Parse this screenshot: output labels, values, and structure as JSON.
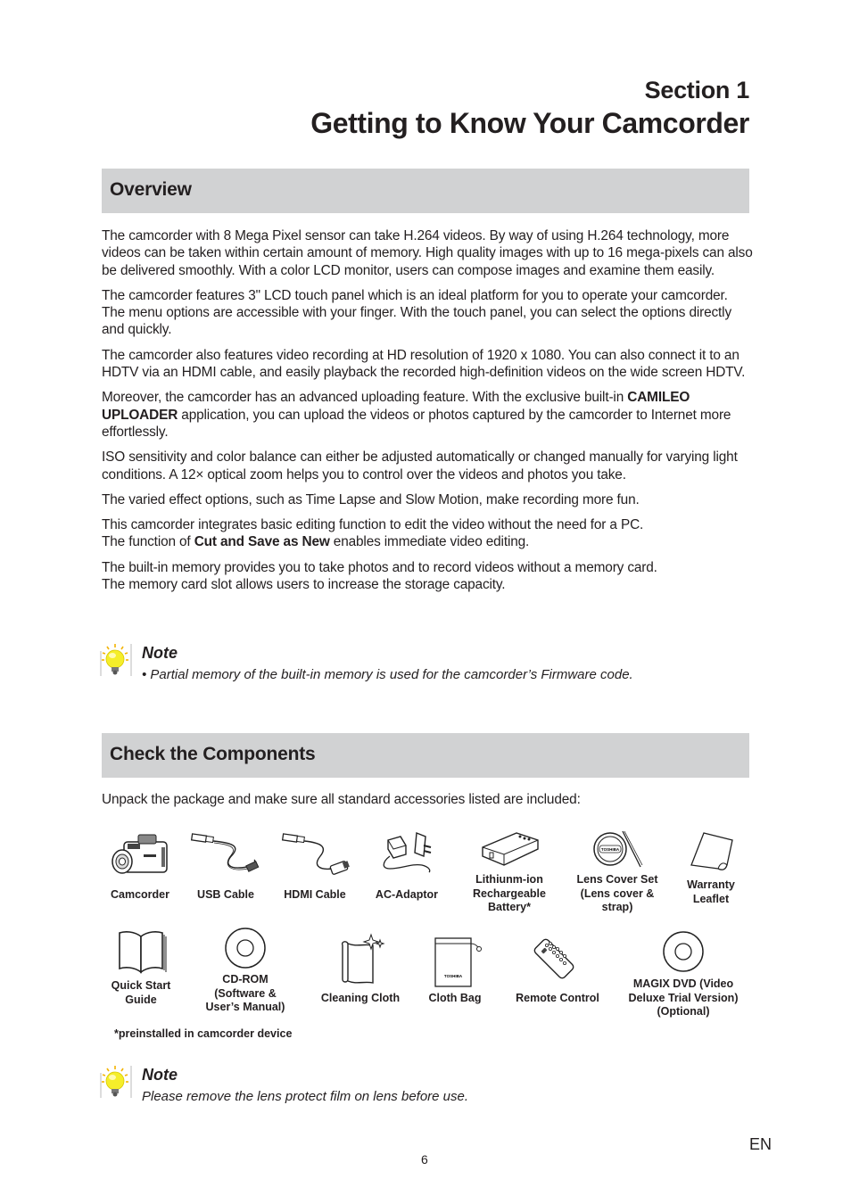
{
  "header": {
    "section_label": "Section 1",
    "title": "Getting to Know Your Camcorder"
  },
  "overview": {
    "heading": "Overview",
    "paragraphs": [
      {
        "parts": [
          {
            "text": "The camcorder with 8 Mega Pixel sensor can take H.264 videos. By way of using H.264 technology, more videos can be taken within certain amount of memory. High quality images with up to 16 mega-pixels can also be delivered smoothly. With a color LCD monitor, users can compose images and examine them easily."
          }
        ]
      },
      {
        "parts": [
          {
            "text": "The camcorder features 3\" LCD touch panel which is an ideal platform for you to operate your camcorder. The menu options are accessible with your finger. With the touch panel, you can select the options directly and quickly."
          }
        ]
      },
      {
        "parts": [
          {
            "text": "The camcorder also features video recording at HD resolution of 1920 x 1080. You can also connect it to an HDTV via an HDMI cable, and easily playback the recorded high-definition videos on the wide screen HDTV."
          }
        ]
      },
      {
        "parts": [
          {
            "text": "Moreover, the camcorder has an advanced uploading feature. With the exclusive built-in "
          },
          {
            "text": "CAMILEO UPLOADER",
            "bold": true
          },
          {
            "text": " application, you can upload the videos or photos captured by the camcorder to Internet more effortlessly."
          }
        ]
      },
      {
        "parts": [
          {
            "text": "ISO sensitivity and color balance can either be adjusted automatically or changed manually for varying light conditions. A 12× optical zoom helps you to control over the videos and photos you take."
          }
        ]
      },
      {
        "parts": [
          {
            "text": "The varied effect options, such as Time Lapse and Slow Motion, make recording more fun."
          }
        ]
      },
      {
        "parts": [
          {
            "text": "This camcorder integrates basic editing function to edit the video without the need for a PC."
          },
          {
            "text": "\n"
          },
          {
            "text": "The function of "
          },
          {
            "text": "Cut and Save as New",
            "bold": true
          },
          {
            "text": " enables immediate video editing."
          }
        ]
      },
      {
        "parts": [
          {
            "text": "The built-in memory provides you to take photos and to record videos without a memory card."
          },
          {
            "text": "\n"
          },
          {
            "text": "The memory card slot allows users to increase the storage capacity."
          }
        ]
      }
    ],
    "note": {
      "title": "Note",
      "text": "•   Partial memory of the built-in memory is used for the camcorder’s Firmware code."
    }
  },
  "components": {
    "heading": "Check the Components",
    "intro": "Unpack the package and make sure all standard accessories listed are included:",
    "items": [
      {
        "icon": "camcorder-icon",
        "label": "Camcorder"
      },
      {
        "icon": "usb-cable-icon",
        "label": "USB Cable"
      },
      {
        "icon": "hdmi-cable-icon",
        "label": "HDMI Cable"
      },
      {
        "icon": "ac-adaptor-icon",
        "label": "AC-Adaptor"
      },
      {
        "icon": "battery-icon",
        "label": "Lithiunm-ion\nRechargeable\nBattery*"
      },
      {
        "icon": "lens-cover-icon",
        "label": "Lens Cover Set\n(Lens cover &\nstrap)"
      },
      {
        "icon": "leaflet-icon",
        "label": "Warranty\nLeaflet"
      },
      {
        "icon": "book-icon",
        "label": "Quick Start\nGuide"
      },
      {
        "icon": "cd-icon",
        "label": "CD-ROM\n(Software &\nUser’s Manual)"
      },
      {
        "icon": "cloth-icon",
        "label": "Cleaning Cloth"
      },
      {
        "icon": "bag-icon",
        "label": "Cloth Bag"
      },
      {
        "icon": "remote-icon",
        "label": "Remote Control"
      },
      {
        "icon": "dvd-icon",
        "label": "MAGIX DVD (Video\nDeluxe Trial Version)\n(Optional)"
      }
    ],
    "footnote": "*preinstalled in camcorder device",
    "brand_mark": "TOSHIBA",
    "note": {
      "title": "Note",
      "text": "Please remove the lens protect film on lens before use."
    }
  },
  "footer": {
    "page_number": "6",
    "language": "EN"
  }
}
